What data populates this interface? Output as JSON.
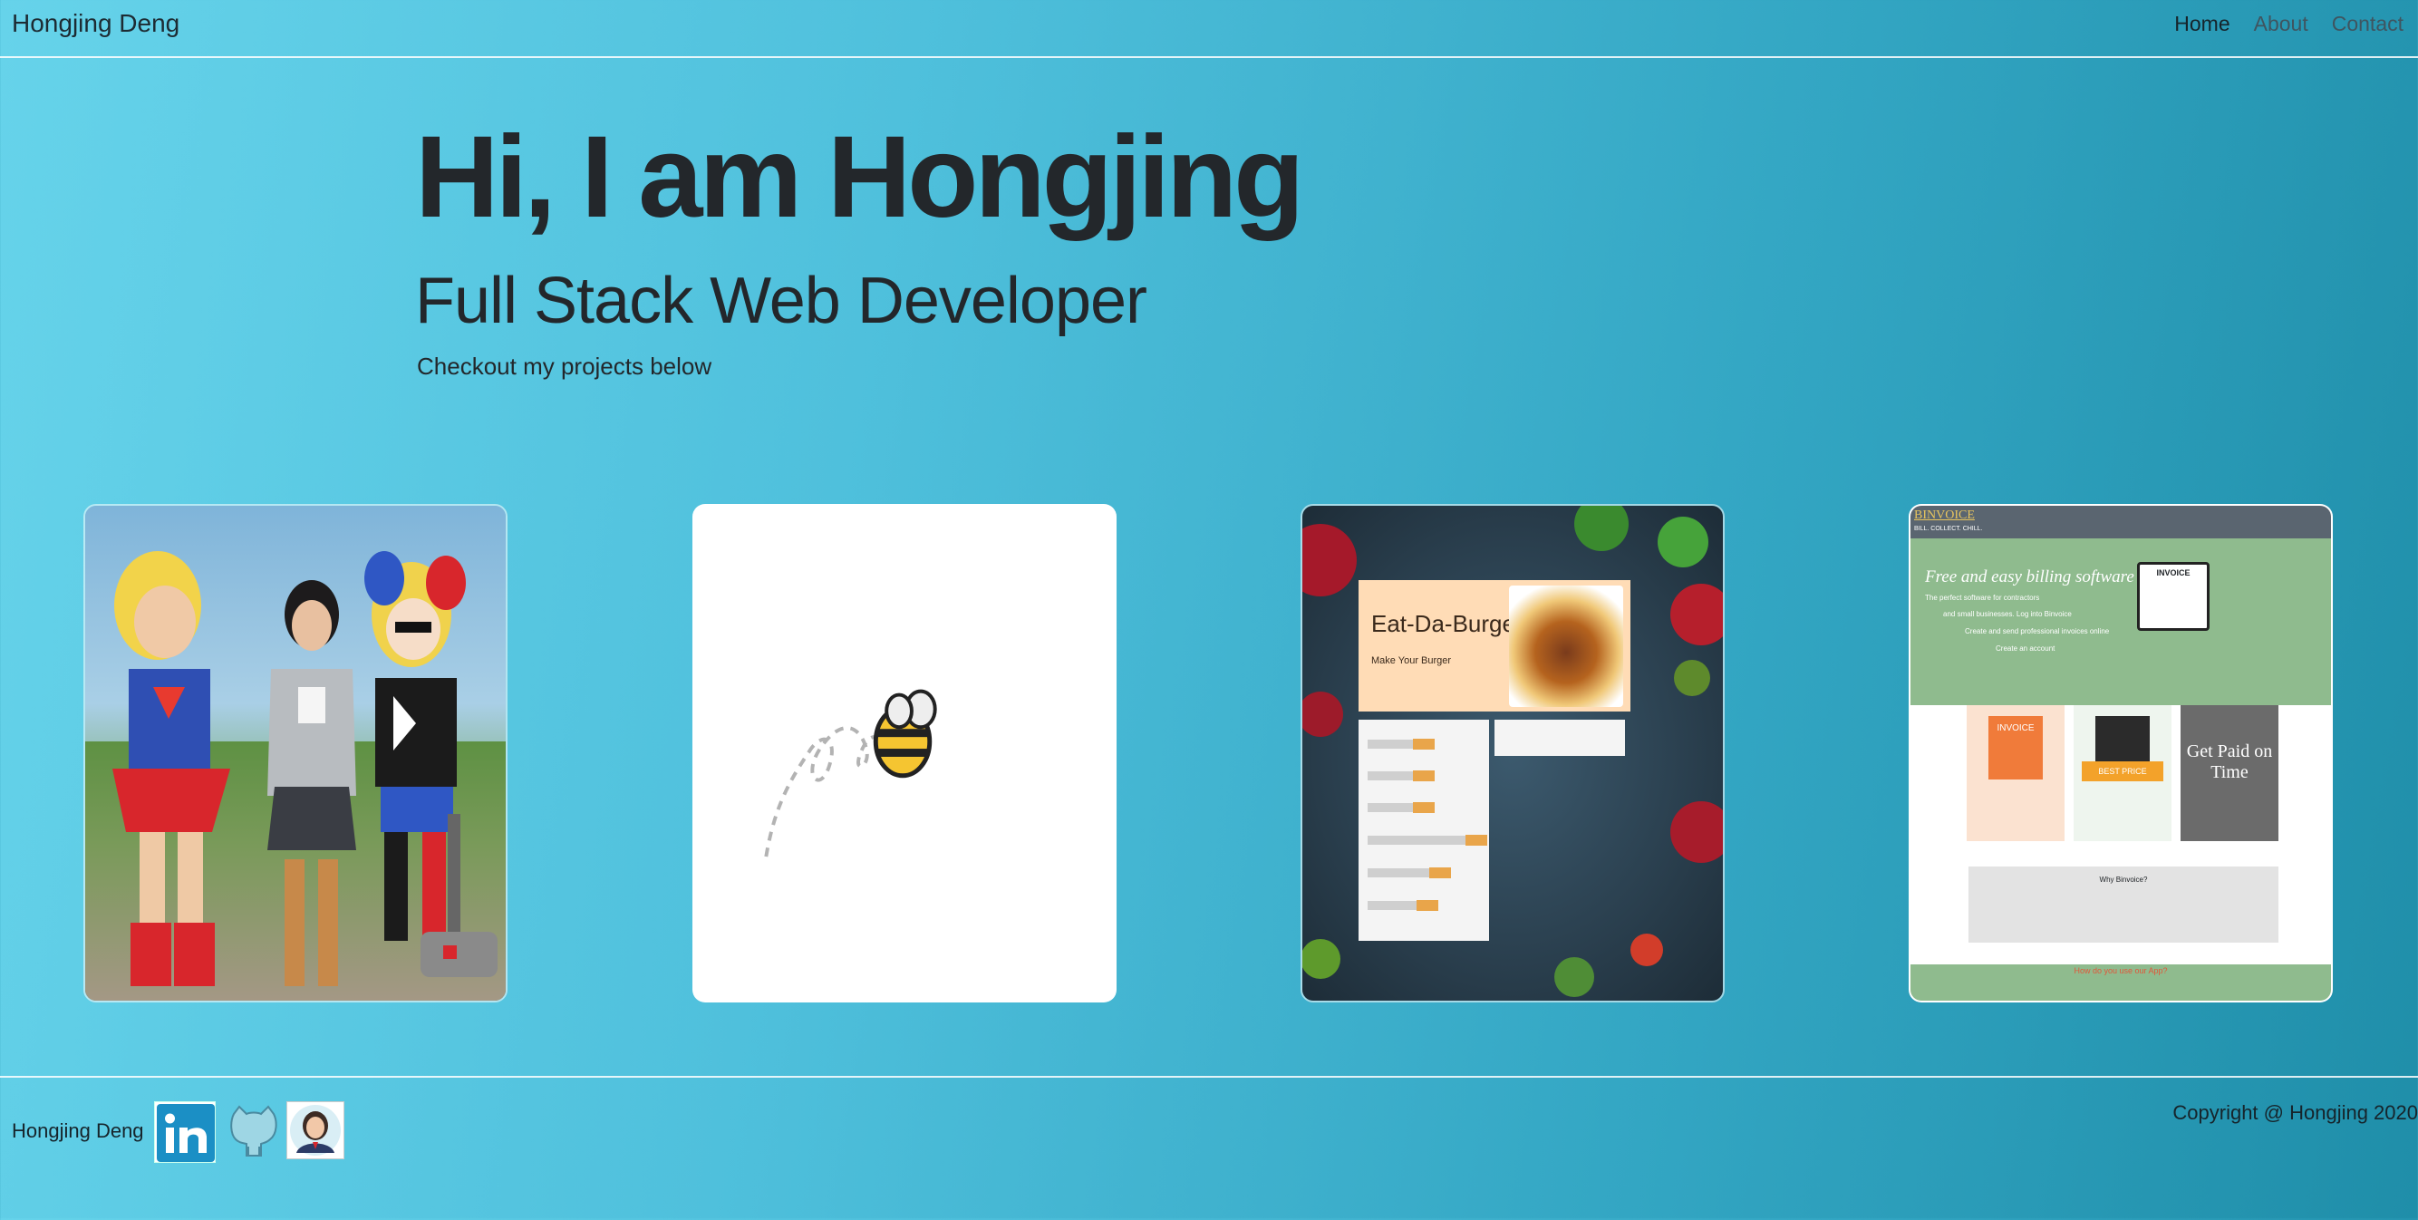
{
  "navbar": {
    "brand": "Hongjing Deng",
    "links": [
      "Home",
      "About",
      "Contact"
    ]
  },
  "hero": {
    "title": "Hi, I am Hongjing",
    "subtitle": "Full Stack Web Developer",
    "lead": "Checkout my projects below"
  },
  "projects": {
    "burger": {
      "title": "Eat-Da-Burger",
      "make": "Make Your Burger"
    },
    "binvoice": {
      "logo": "BINVOICE",
      "tagline": "BILL. COLLECT. CHILL.",
      "headline": "Free and easy billing software",
      "lines": [
        "The perfect software for contractors",
        "and small businesses. Log into Binvoice",
        "Create and send professional invoices online",
        "Create an account"
      ],
      "invoice_label": "INVOICE",
      "tiles": [
        "INVOICE",
        "BEST PRICE",
        "Get Paid on Time"
      ],
      "why": "Why Binvoice?",
      "bottom": "How do you use our App?"
    }
  },
  "footer": {
    "name": "Hongjing Deng",
    "copyright": "Copyright @ Hongjing 2020"
  },
  "colors": {
    "bg_start": "#66d3ea",
    "bg_end": "#1f8ea9",
    "text_dark": "#23272b"
  },
  "icons": [
    "linkedin-icon",
    "github-icon",
    "avatar-icon"
  ]
}
